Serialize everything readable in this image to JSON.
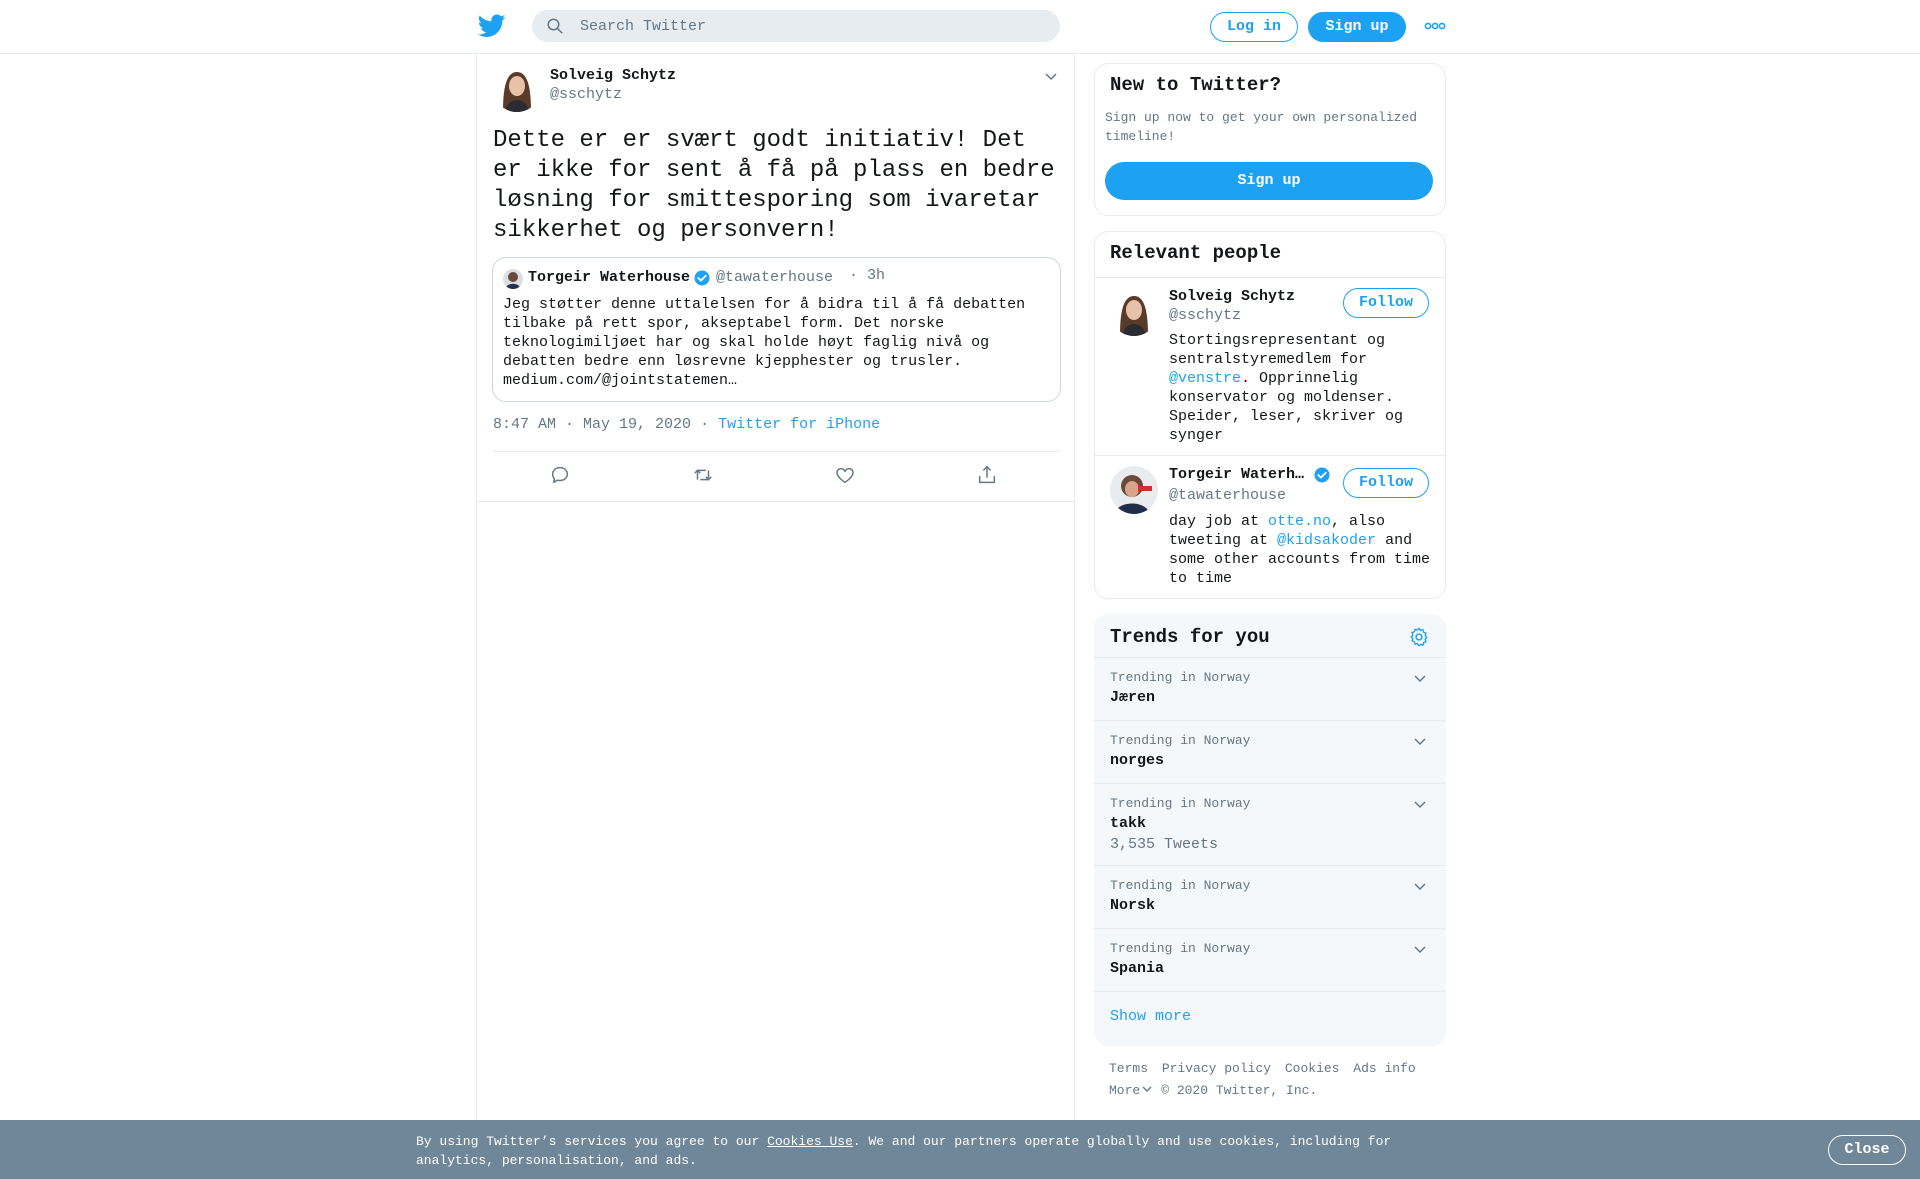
{
  "header": {
    "search_placeholder": "Search Twitter",
    "login_label": "Log in",
    "signup_label": "Sign up",
    "brand_color": "#1da1f2"
  },
  "tweet": {
    "author_name": "Solveig Schytz",
    "author_handle": "@sschytz",
    "text": "Dette er er svært godt initiativ! Det er ikke for sent å få på plass en bedre løsning for smittesporing som ivaretar sikkerhet og personvern!",
    "timestamp": "8:47 AM · May 19, 2020",
    "separator": "·",
    "source": "Twitter for iPhone",
    "quote": {
      "author_name": "Torgeir Waterhouse",
      "author_handle": "@tawaterhouse",
      "time": "· 3h",
      "text": "Jeg støtter denne uttalelsen for å bidra til å få debatten tilbake på rett spor, akseptabel form. Det norske teknologimiljøet har og skal holde høyt faglig nivå og debatten bedre enn løsrevne kjepphester og trusler. medium.com/@jointstatemen…"
    }
  },
  "new_to_twitter": {
    "title": "New to Twitter?",
    "subtitle": "Sign up now to get your own personalized timeline!",
    "button": "Sign up"
  },
  "relevant_people": {
    "title": "Relevant people",
    "people": [
      {
        "name": "Solveig Schytz",
        "handle": "@sschytz",
        "follow": "Follow",
        "bio_a": "Stortingsrepresentant og sentralstyremedlem for ",
        "bio_link": "@venstre",
        "bio_b": ". Opprinnelig konservator og moldenser. Speider, leser, skriver og synger"
      },
      {
        "name": "Torgeir Waterh…",
        "handle": "@tawaterhouse",
        "follow": "Follow",
        "bio_a": "day job at ",
        "bio_link": "otte.no",
        "bio_b": ", also tweeting at ",
        "bio_link2": "@kidsakoder",
        "bio_c": " and some other accounts from time to time"
      }
    ]
  },
  "trends": {
    "title": "Trends for you",
    "items": [
      {
        "context": "Trending in Norway",
        "name": "Jæren",
        "count": ""
      },
      {
        "context": "Trending in Norway",
        "name": "norges",
        "count": ""
      },
      {
        "context": "Trending in Norway",
        "name": "takk",
        "count": "3,535 Tweets"
      },
      {
        "context": "Trending in Norway",
        "name": "Norsk",
        "count": ""
      },
      {
        "context": "Trending in Norway",
        "name": "Spania",
        "count": ""
      }
    ],
    "show_more": "Show more"
  },
  "footer": {
    "terms": "Terms",
    "privacy": "Privacy policy",
    "cookies": "Cookies",
    "ads": "Ads info",
    "more": "More",
    "copyright": "© 2020 Twitter, Inc."
  },
  "cookie_bar": {
    "text_a": "By using Twitter’s services you agree to our ",
    "link": "Cookies Use",
    "text_b": ". We and our partners operate globally and use cookies, including for analytics, personalisation, and ads.",
    "close": "Close"
  }
}
